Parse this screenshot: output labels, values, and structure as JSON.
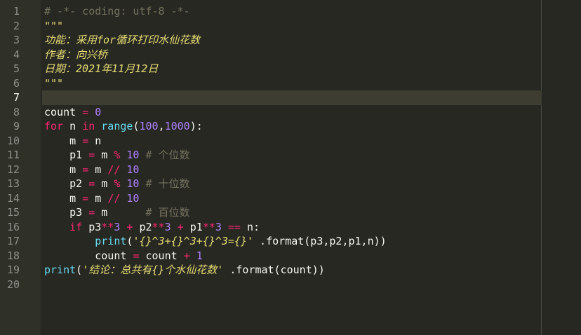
{
  "editor": {
    "line_numbers": [
      "1",
      "2",
      "3",
      "4",
      "5",
      "6",
      "7",
      "8",
      "9",
      "10",
      "11",
      "12",
      "13",
      "14",
      "15",
      "16",
      "17",
      "18",
      "19",
      "20"
    ],
    "current_line": 7,
    "lines": [
      [
        {
          "t": "cm",
          "v": "# -*- coding: utf-8 -*-"
        }
      ],
      [
        {
          "t": "docstr",
          "v": "\"\"\""
        }
      ],
      [
        {
          "t": "docstr",
          "v": "功能：采用for循环打印水仙花数"
        }
      ],
      [
        {
          "t": "docstr",
          "v": "作者：向兴桥"
        }
      ],
      [
        {
          "t": "docstr",
          "v": "日期：2021年11月12日"
        }
      ],
      [
        {
          "t": "docstr",
          "v": "\"\"\""
        }
      ],
      [],
      [
        {
          "t": "plain",
          "v": "count "
        },
        {
          "t": "op",
          "v": "="
        },
        {
          "t": "plain",
          "v": " "
        },
        {
          "t": "num",
          "v": "0"
        }
      ],
      [
        {
          "t": "kw",
          "v": "for"
        },
        {
          "t": "plain",
          "v": " n "
        },
        {
          "t": "kw",
          "v": "in"
        },
        {
          "t": "plain",
          "v": " "
        },
        {
          "t": "fn",
          "v": "range"
        },
        {
          "t": "plain",
          "v": "("
        },
        {
          "t": "num",
          "v": "100"
        },
        {
          "t": "plain",
          "v": ","
        },
        {
          "t": "num",
          "v": "1000"
        },
        {
          "t": "plain",
          "v": "):"
        }
      ],
      [
        {
          "t": "plain",
          "v": "    m "
        },
        {
          "t": "op",
          "v": "="
        },
        {
          "t": "plain",
          "v": " n"
        }
      ],
      [
        {
          "t": "plain",
          "v": "    p1 "
        },
        {
          "t": "op",
          "v": "="
        },
        {
          "t": "plain",
          "v": " m "
        },
        {
          "t": "op",
          "v": "%"
        },
        {
          "t": "plain",
          "v": " "
        },
        {
          "t": "num",
          "v": "10"
        },
        {
          "t": "plain",
          "v": " "
        },
        {
          "t": "cm",
          "v": "# 个位数"
        }
      ],
      [
        {
          "t": "plain",
          "v": "    m "
        },
        {
          "t": "op",
          "v": "="
        },
        {
          "t": "plain",
          "v": " m "
        },
        {
          "t": "op",
          "v": "//"
        },
        {
          "t": "plain",
          "v": " "
        },
        {
          "t": "num",
          "v": "10"
        }
      ],
      [
        {
          "t": "plain",
          "v": "    p2 "
        },
        {
          "t": "op",
          "v": "="
        },
        {
          "t": "plain",
          "v": " m "
        },
        {
          "t": "op",
          "v": "%"
        },
        {
          "t": "plain",
          "v": " "
        },
        {
          "t": "num",
          "v": "10"
        },
        {
          "t": "plain",
          "v": " "
        },
        {
          "t": "cm",
          "v": "# 十位数"
        }
      ],
      [
        {
          "t": "plain",
          "v": "    m "
        },
        {
          "t": "op",
          "v": "="
        },
        {
          "t": "plain",
          "v": " m "
        },
        {
          "t": "op",
          "v": "//"
        },
        {
          "t": "plain",
          "v": " "
        },
        {
          "t": "num",
          "v": "10"
        }
      ],
      [
        {
          "t": "plain",
          "v": "    p3 "
        },
        {
          "t": "op",
          "v": "="
        },
        {
          "t": "plain",
          "v": " m      "
        },
        {
          "t": "cm",
          "v": "# 百位数"
        }
      ],
      [
        {
          "t": "plain",
          "v": "    "
        },
        {
          "t": "kw",
          "v": "if"
        },
        {
          "t": "plain",
          "v": " p3"
        },
        {
          "t": "op",
          "v": "**"
        },
        {
          "t": "num",
          "v": "3"
        },
        {
          "t": "plain",
          "v": " "
        },
        {
          "t": "op",
          "v": "+"
        },
        {
          "t": "plain",
          "v": " p2"
        },
        {
          "t": "op",
          "v": "**"
        },
        {
          "t": "num",
          "v": "3"
        },
        {
          "t": "plain",
          "v": " "
        },
        {
          "t": "op",
          "v": "+"
        },
        {
          "t": "plain",
          "v": " p1"
        },
        {
          "t": "op",
          "v": "**"
        },
        {
          "t": "num",
          "v": "3"
        },
        {
          "t": "plain",
          "v": " "
        },
        {
          "t": "op",
          "v": "=="
        },
        {
          "t": "plain",
          "v": " n:"
        }
      ],
      [
        {
          "t": "plain",
          "v": "        "
        },
        {
          "t": "fn",
          "v": "print"
        },
        {
          "t": "plain",
          "v": "("
        },
        {
          "t": "strcn",
          "v": "'{}^3+{}^3+{}^3={}'"
        },
        {
          "t": "plain",
          "v": " .format(p3,p2,p1,n))"
        }
      ],
      [
        {
          "t": "plain",
          "v": "        count "
        },
        {
          "t": "op",
          "v": "="
        },
        {
          "t": "plain",
          "v": " count "
        },
        {
          "t": "op",
          "v": "+"
        },
        {
          "t": "plain",
          "v": " "
        },
        {
          "t": "num",
          "v": "1"
        }
      ],
      [
        {
          "t": "fn",
          "v": "print"
        },
        {
          "t": "plain",
          "v": "("
        },
        {
          "t": "strcn",
          "v": "'结论：总共有{}个水仙花数'"
        },
        {
          "t": "plain",
          "v": " .format(count))"
        }
      ],
      []
    ]
  }
}
